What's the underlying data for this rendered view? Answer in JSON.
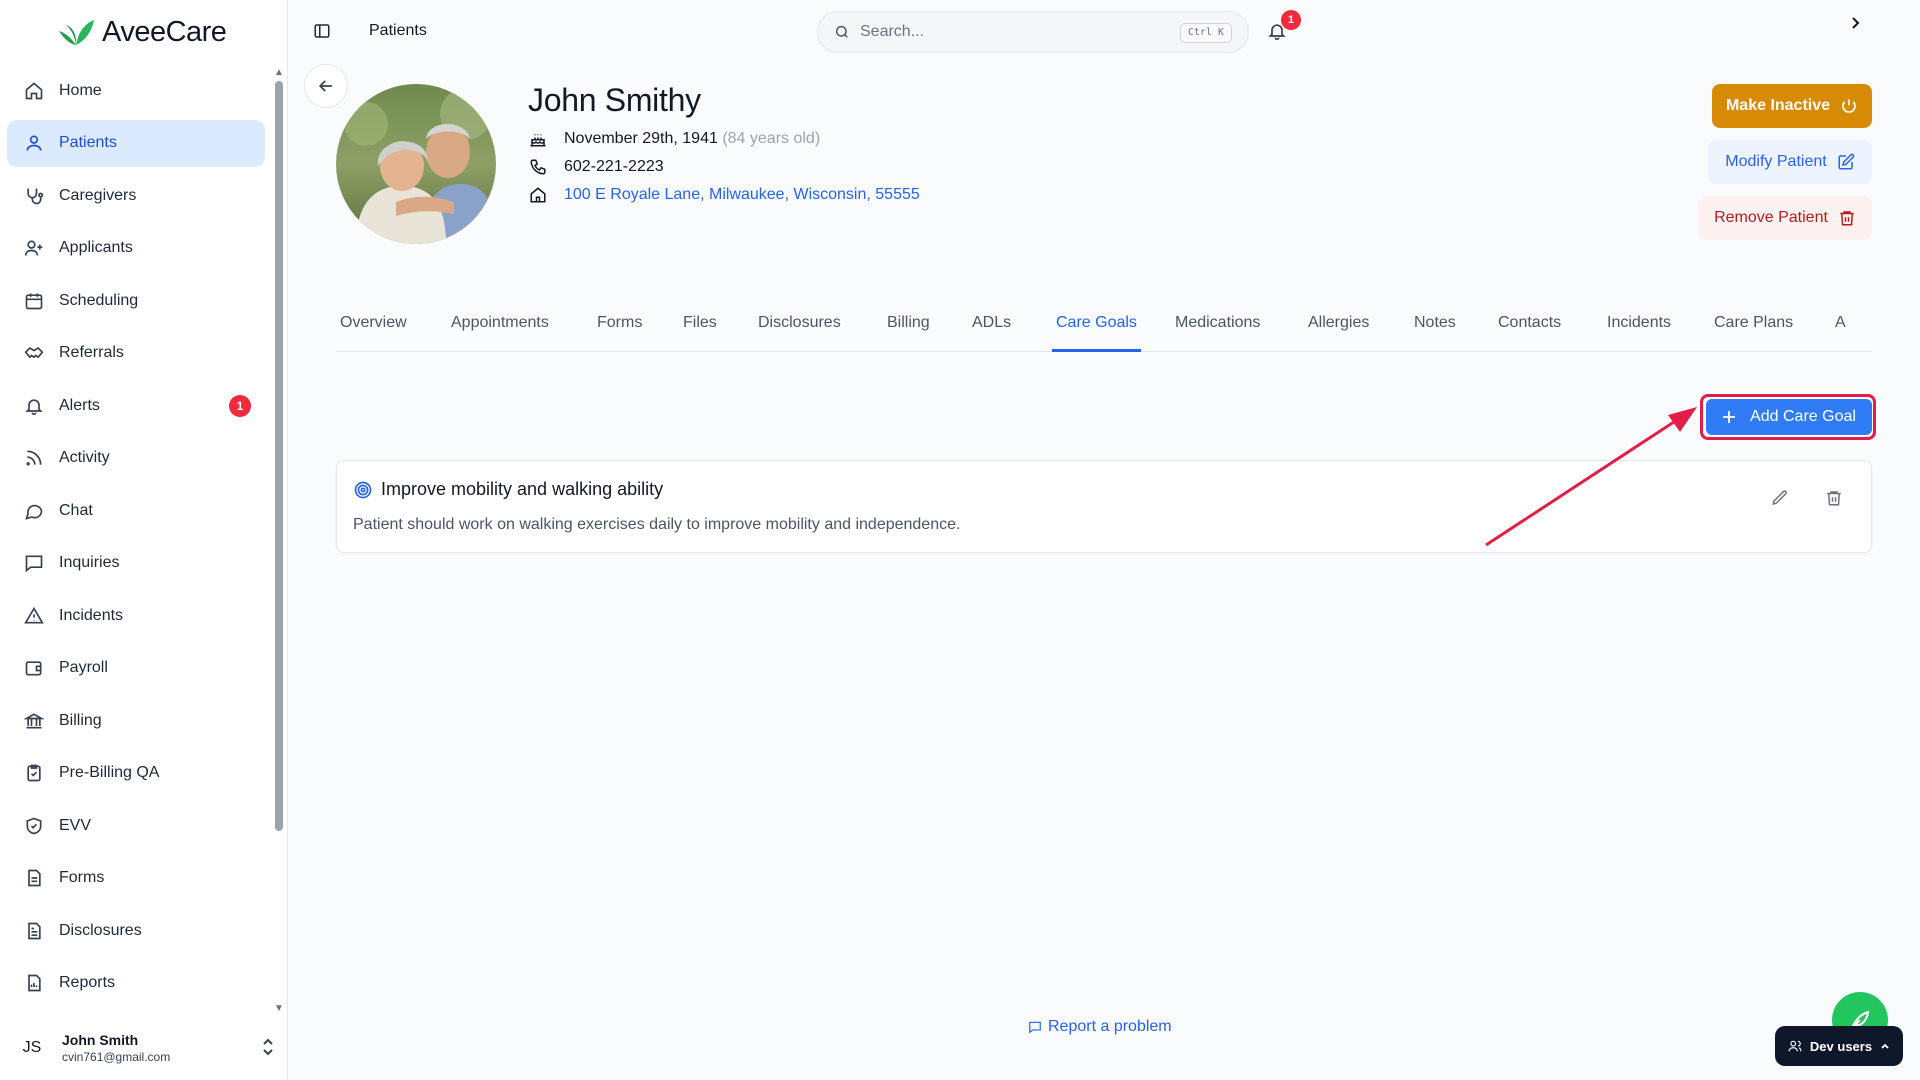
{
  "app": {
    "name": "AveeCare"
  },
  "sidebar": {
    "items": [
      {
        "label": "Home",
        "icon": "home-icon"
      },
      {
        "label": "Patients",
        "icon": "user-icon",
        "active": true
      },
      {
        "label": "Caregivers",
        "icon": "stethoscope-icon"
      },
      {
        "label": "Applicants",
        "icon": "user-plus-icon"
      },
      {
        "label": "Scheduling",
        "icon": "calendar-icon"
      },
      {
        "label": "Referrals",
        "icon": "handshake-icon"
      },
      {
        "label": "Alerts",
        "icon": "bell-icon",
        "badge": "1"
      },
      {
        "label": "Activity",
        "icon": "rss-icon"
      },
      {
        "label": "Chat",
        "icon": "chat-bubble-icon"
      },
      {
        "label": "Inquiries",
        "icon": "message-square-icon"
      },
      {
        "label": "Incidents",
        "icon": "warning-icon"
      },
      {
        "label": "Payroll",
        "icon": "wallet-icon"
      },
      {
        "label": "Billing",
        "icon": "bank-icon"
      },
      {
        "label": "Pre-Billing QA",
        "icon": "clipboard-check-icon"
      },
      {
        "label": "EVV",
        "icon": "shield-check-icon"
      },
      {
        "label": "Forms",
        "icon": "form-icon"
      },
      {
        "label": "Disclosures",
        "icon": "document-icon"
      },
      {
        "label": "Reports",
        "icon": "report-icon"
      }
    ],
    "user": {
      "initials": "JS",
      "name": "John Smith",
      "email": "cvin761@gmail.com"
    }
  },
  "header": {
    "breadcrumb": "Patients",
    "search_placeholder": "Search...",
    "shortcut": "Ctrl K",
    "notifications": "1"
  },
  "patient": {
    "name": "John Smithy",
    "dob": "November 29th, 1941",
    "age": "(84 years old)",
    "phone": "602-221-2223",
    "address": "100 E Royale Lane, Milwaukee, Wisconsin, 55555"
  },
  "actions": {
    "make_inactive": "Make Inactive",
    "modify": "Modify Patient",
    "remove": "Remove Patient"
  },
  "tabs": [
    {
      "label": "Overview"
    },
    {
      "label": "Appointments"
    },
    {
      "label": "Forms"
    },
    {
      "label": "Files"
    },
    {
      "label": "Disclosures"
    },
    {
      "label": "Billing"
    },
    {
      "label": "ADLs"
    },
    {
      "label": "Care Goals",
      "active": true
    },
    {
      "label": "Medications"
    },
    {
      "label": "Allergies"
    },
    {
      "label": "Notes"
    },
    {
      "label": "Contacts"
    },
    {
      "label": "Incidents"
    },
    {
      "label": "Care Plans"
    },
    {
      "label": "A"
    }
  ],
  "care_goals": {
    "add_label": "Add Care Goal",
    "goals": [
      {
        "title": "Improve mobility and walking ability",
        "description": "Patient should work on walking exercises daily to improve mobility and independence."
      }
    ]
  },
  "footer": {
    "report": "Report a problem",
    "dev_users": "Dev users"
  },
  "colors": {
    "primary": "#2f7cf6",
    "active_nav_bg": "#dbeafe",
    "inactive_button": "#d68a06",
    "danger": "#b91c1c",
    "annotation": "#e11d48",
    "badge": "#ef2b3c"
  }
}
